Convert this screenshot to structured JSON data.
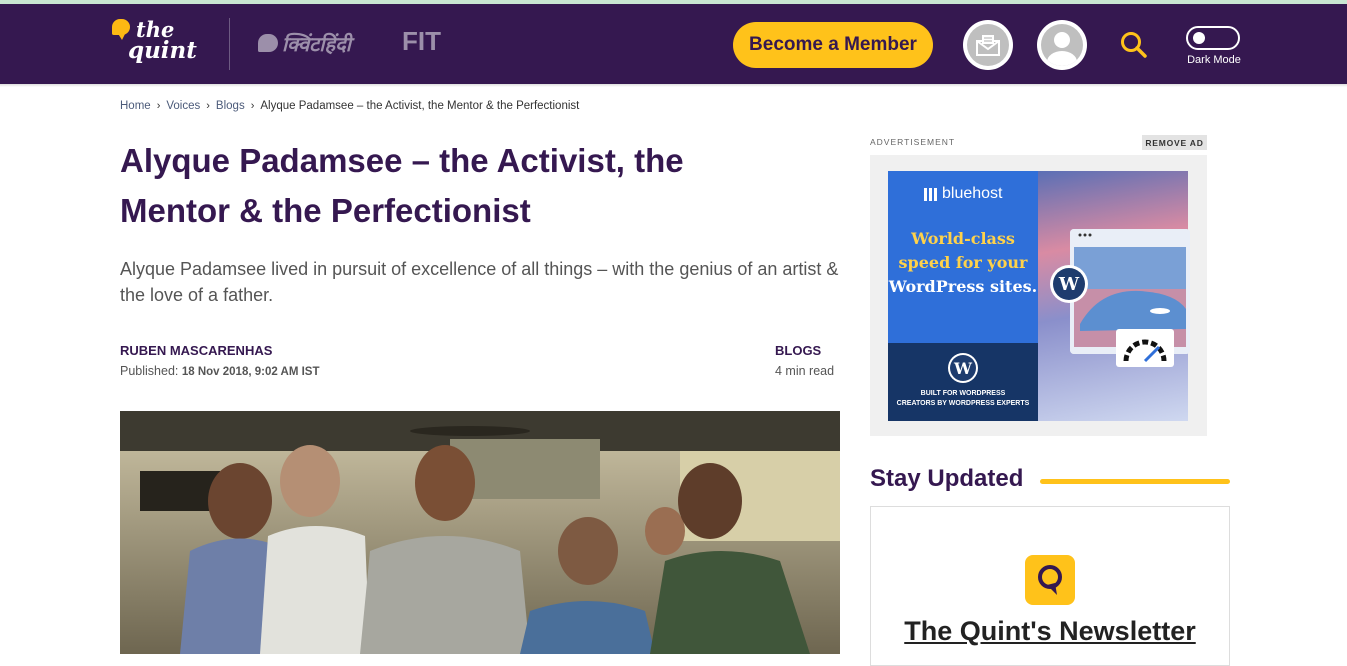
{
  "header": {
    "logo_top": "the",
    "logo_bottom": "quint",
    "hindi_logo": "क्विंटहिंदी",
    "fit_logo": "FIT",
    "member_button": "Become a Member",
    "dark_mode_label": "Dark Mode",
    "colors": {
      "background": "#351850",
      "accent": "#ffc21a"
    },
    "icons": [
      "newsletter-icon",
      "user-avatar-icon",
      "search-icon",
      "dark-mode-toggle"
    ]
  },
  "breadcrumb": [
    {
      "label": "Home"
    },
    {
      "label": "Voices"
    },
    {
      "label": "Blogs"
    },
    {
      "label": "Alyque Padamsee – the Activist, the Mentor & the Perfectionist"
    }
  ],
  "article": {
    "title": "Alyque Padamsee – the Activist, the Mentor & the Perfectionist",
    "subheadline": "Alyque Padamsee lived in pursuit of excellence of all things – with the genius of an artist & the love of a father.",
    "author": "RUBEN MASCARENHAS",
    "published_label": "Published:",
    "published_date": "18 Nov 2018, 9:02 AM IST",
    "section": "BLOGS",
    "read_time": "4 min read"
  },
  "sidebar": {
    "ad_label": "ADVERTISEMENT",
    "remove_ad": "REMOVE AD",
    "ad": {
      "brand": "bluehost",
      "headline_highlight": "World-class speed for your",
      "headline_rest": "WordPress sites.",
      "footer_line1": "BUILT FOR WORDPRESS",
      "footer_line2": "CREATORS BY WORDPRESS EXPERTS"
    },
    "stay_updated": "Stay Updated",
    "newsletter_title": "The Quint's Newsletter"
  }
}
